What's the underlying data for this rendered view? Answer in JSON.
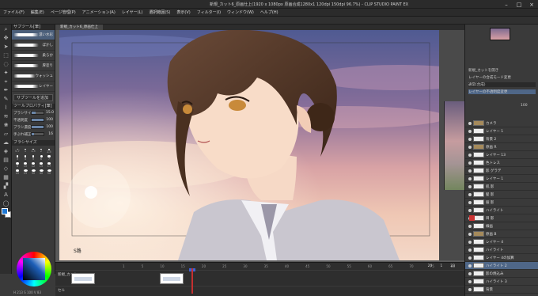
{
  "window": {
    "title": "新規_カット6_原画仕上(1920 x 1080px 原画合成1280x1 120dpi 150dpi 96.7%) - CLIP STUDIO PAINT EX",
    "controls": [
      "minimize-icon",
      "maximize-icon",
      "close-icon"
    ]
  },
  "menu": [
    "ファイル(F)",
    "編集(E)",
    "ページ管理(P)",
    "アニメーション(A)",
    "レイヤー(L)",
    "選択範囲(S)",
    "表示(V)",
    "フィルター(I)",
    "ウィンドウ(W)",
    "ヘルプ(H)"
  ],
  "canvas": {
    "tab_label": "新規_カット6_原画仕上",
    "signature": "S路"
  },
  "subtool_panel": {
    "header": "サブツール[筆]",
    "brushes": [
      {
        "name": "濃い水彩"
      },
      {
        "name": "ぼかし"
      },
      {
        "name": "柔らか"
      },
      {
        "name": "厚塗り"
      },
      {
        "name": "ウォッシュ"
      },
      {
        "name": "レイヤー"
      }
    ],
    "add_button": "サブツールを追加",
    "properties_header": "ツールプロパティ[筆]",
    "properties": [
      {
        "label": "ブラシサイズ",
        "value": "15.0",
        "level": 0.35
      },
      {
        "label": "不透明度",
        "value": "100",
        "level": 1.0
      },
      {
        "label": "ブラシ濃度",
        "value": "100",
        "level": 1.0
      },
      {
        "label": "手ぶれ補正",
        "value": "16",
        "level": 0.2
      }
    ],
    "size_header": "ブラシサイズ",
    "sizes": [
      "0.7",
      "1",
      "1.5",
      "2",
      "2.5",
      "3",
      "4",
      "5",
      "6",
      "7",
      "8",
      "10",
      "12",
      "15",
      "17",
      "20",
      "25",
      "30",
      "40",
      "50"
    ]
  },
  "color": {
    "main": "#1f78d4",
    "sub": "#ffffff",
    "hsv_readout": "H 213 S 100 V 83"
  },
  "timeline": {
    "header": "タイムライン",
    "tracks": [
      "新規_カット",
      "セル"
    ],
    "ruler": [
      "1",
      "5",
      "10",
      "15",
      "20",
      "25",
      "30",
      "35",
      "40",
      "45",
      "50",
      "55",
      "60",
      "65",
      "70",
      "75",
      "80"
    ],
    "frame_display": [
      "20",
      "1",
      "23"
    ]
  },
  "right_panel": {
    "sections": [
      "新規_カットを開き",
      "レイヤーの合成モード変更",
      "通常(合成)",
      "レイヤーの不透明度変更"
    ],
    "opacity": "100",
    "layers": [
      {
        "name": "カメラ",
        "type": "folder"
      },
      {
        "name": "レイヤー 1",
        "type": "layer"
      },
      {
        "name": "背景 2",
        "type": "layer"
      },
      {
        "name": "原画 R",
        "type": "folder"
      },
      {
        "name": "レイヤー 13",
        "type": "layer"
      },
      {
        "name": "色トレス",
        "type": "layer"
      },
      {
        "name": "影 グラデ",
        "type": "layer"
      },
      {
        "name": "レイヤー 1",
        "type": "layer"
      },
      {
        "name": "肌 影",
        "type": "layer"
      },
      {
        "name": "髪 影",
        "type": "layer"
      },
      {
        "name": "服 影",
        "type": "layer"
      },
      {
        "name": "ハイライト",
        "type": "layer"
      },
      {
        "name": "目 影",
        "type": "layer"
      },
      {
        "name": "線画",
        "type": "layer"
      },
      {
        "name": "原画 B",
        "type": "folder"
      },
      {
        "name": "レイヤー 4",
        "type": "layer"
      },
      {
        "name": "ハイライト",
        "type": "layer"
      },
      {
        "name": "レイヤー 4の加算",
        "type": "layer"
      },
      {
        "name": "ハイライト 2",
        "type": "layer",
        "selected": true
      },
      {
        "name": "影の焼込み",
        "type": "layer"
      },
      {
        "name": "ハイライト 3",
        "type": "layer"
      },
      {
        "name": "背景",
        "type": "layer"
      }
    ]
  }
}
